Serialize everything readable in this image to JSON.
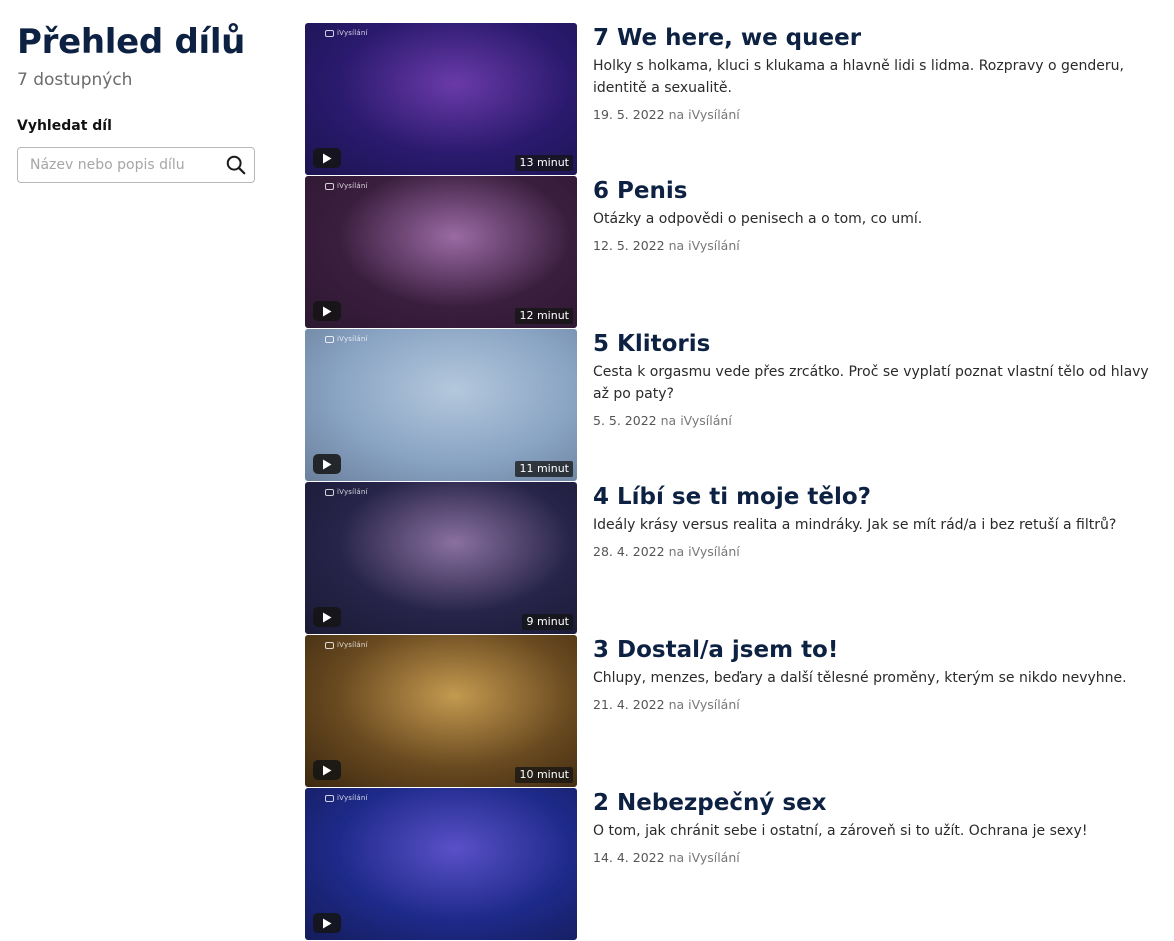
{
  "sidebar": {
    "title": "Přehled dílů",
    "count": "7 dostupných",
    "search_label": "Vyhledat díl",
    "search_placeholder": "Název nebo popis dílu",
    "search_icon": "search-icon"
  },
  "episodes": [
    {
      "title": "7 We here, we queer",
      "description": "Holky s holkama, kluci s klukama a hlavně lidi s lidma. Rozpravy o genderu, identitě a sexualitě.",
      "date": "19. 5. 2022",
      "on": "na",
      "platform": "iVysílání",
      "duration": "13 minut",
      "logo": "iVysílání",
      "thumb_colors": [
        "#2a1a6e",
        "#6a3aa8",
        "#1c1450"
      ]
    },
    {
      "title": "6 Penis",
      "description": "Otázky a odpovědi o penisech a o tom, co umí.",
      "date": "12. 5. 2022",
      "on": "na",
      "platform": "iVysílání",
      "duration": "12 minut",
      "logo": "iVysílání",
      "thumb_colors": [
        "#3a1e3e",
        "#9a6aa4",
        "#2c1830"
      ]
    },
    {
      "title": "5 Klitoris",
      "description": "Cesta k orgasmu vede přes zrcátko. Proč se vyplatí poznat vlastní tělo od hlavy až po paty?",
      "date": "5. 5. 2022",
      "on": "na",
      "platform": "iVysílání",
      "duration": "11 minut",
      "logo": "iVysílání",
      "thumb_colors": [
        "#8aa4c4",
        "#b4c8dc",
        "#6a809c"
      ]
    },
    {
      "title": "4 Líbí se ti moje tělo?",
      "description": "Ideály krásy versus realita a mindráky. Jak se mít rád/a i bez retuší a filtrů?",
      "date": "28. 4. 2022",
      "on": "na",
      "platform": "iVysílání",
      "duration": "9 minut",
      "logo": "iVysílání",
      "thumb_colors": [
        "#262448",
        "#8a70a0",
        "#1a1a36"
      ]
    },
    {
      "title": "3 Dostal/a jsem to!",
      "description": "Chlupy, menzes, beďary a další tělesné proměny, kterým se nikdo nevyhne.",
      "date": "21. 4. 2022",
      "on": "na",
      "platform": "iVysílání",
      "duration": "10 minut",
      "logo": "iVysílání",
      "thumb_colors": [
        "#6a4a20",
        "#c49a50",
        "#3a2810"
      ]
    },
    {
      "title": "2 Nebezpečný sex",
      "description": "O tom, jak chránit sebe i ostatní, a zároveň si to užít. Ochrana je sexy!",
      "date": "14. 4. 2022",
      "on": "na",
      "platform": "iVysílání",
      "duration": "",
      "logo": "iVysílání",
      "thumb_colors": [
        "#1e2a8a",
        "#5a50c8",
        "#141c5a"
      ]
    }
  ]
}
